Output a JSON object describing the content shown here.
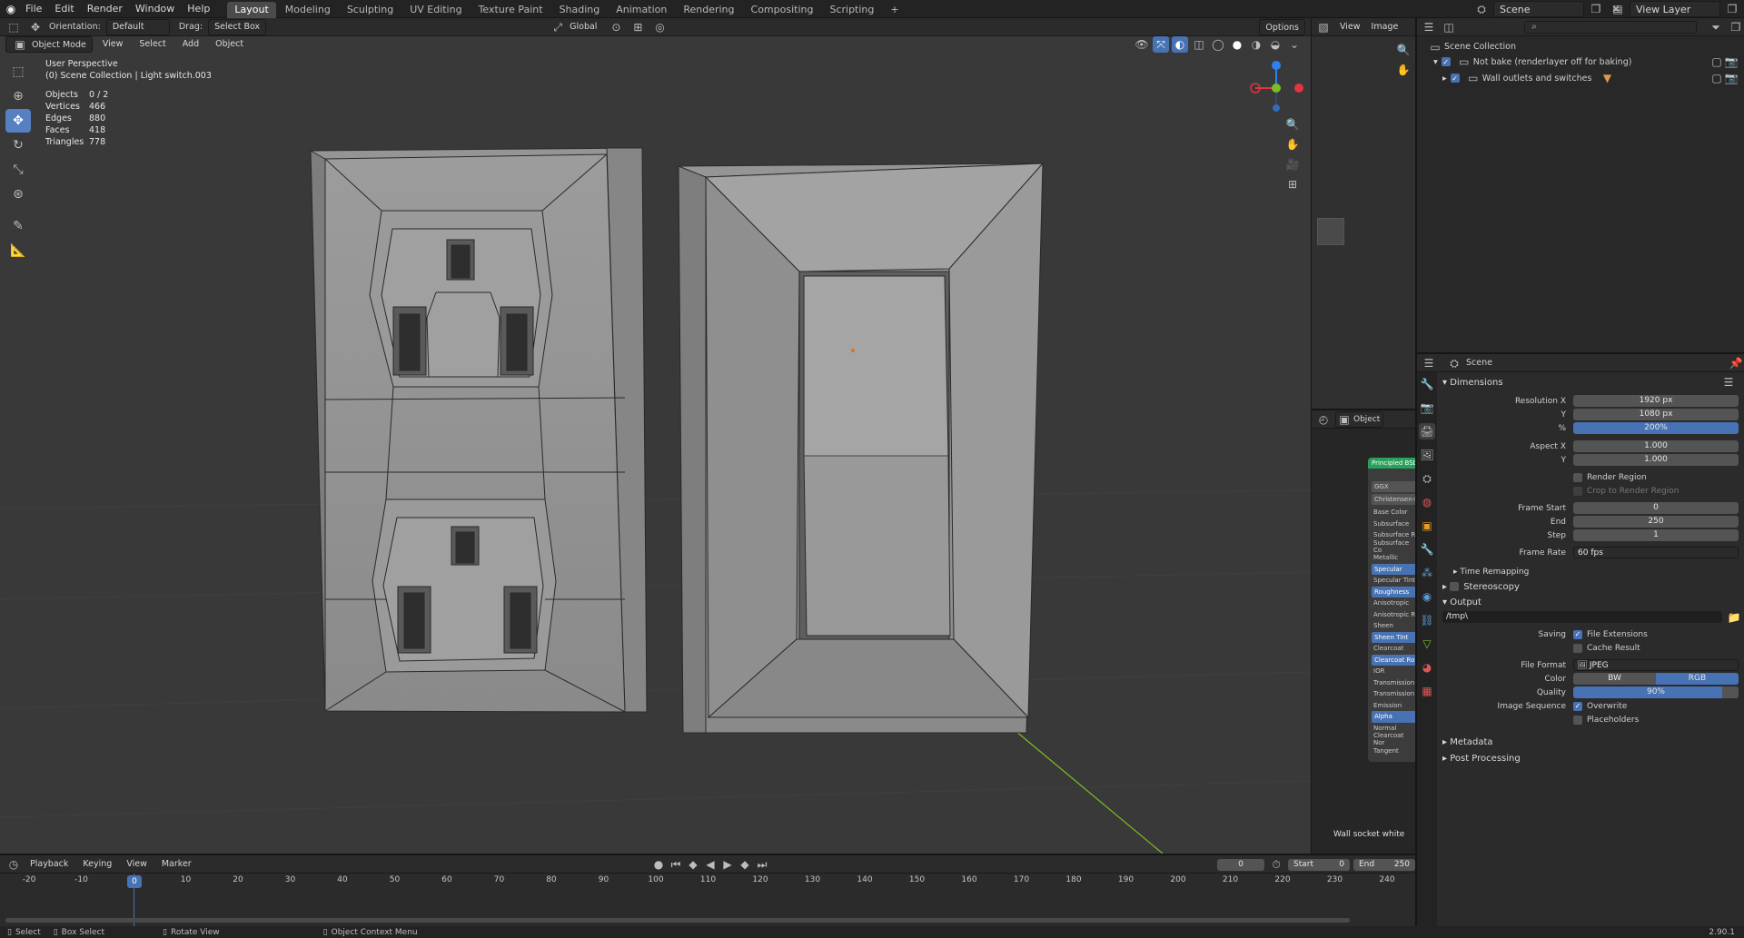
{
  "app": {
    "name": "Blender",
    "version": "2.90.1"
  },
  "menus": [
    "File",
    "Edit",
    "Render",
    "Window",
    "Help"
  ],
  "workspaces": [
    "Layout",
    "Modeling",
    "Sculpting",
    "UV Editing",
    "Texture Paint",
    "Shading",
    "Animation",
    "Rendering",
    "Compositing",
    "Scripting"
  ],
  "active_workspace": "Layout",
  "scene_name": "Scene",
  "view_layer": "View Layer",
  "viewport": {
    "orientation_label": "Orientation:",
    "orientation_value": "Default",
    "drag_label": "Drag:",
    "drag_value": "Select Box",
    "transform_orientation": "Global",
    "options": "Options",
    "mode": "Object Mode",
    "menus": [
      "View",
      "Select",
      "Add",
      "Object"
    ],
    "overlay_title": "User Perspective",
    "overlay_subtitle": "(0) Scene Collection | Light switch.003",
    "stats": [
      {
        "label": "Objects",
        "value": "0 / 2"
      },
      {
        "label": "Vertices",
        "value": "466"
      },
      {
        "label": "Edges",
        "value": "880"
      },
      {
        "label": "Faces",
        "value": "418"
      },
      {
        "label": "Triangles",
        "value": "778"
      }
    ],
    "gizmo_axes": [
      "X",
      "Y",
      "Z"
    ],
    "colors": {
      "bg": "#393939",
      "x": "#e3343f",
      "y": "#7bbd26",
      "z": "#2f80ed",
      "mesh": "#9a9a9a"
    }
  },
  "image_editor": {
    "menus": [
      "View",
      "Image"
    ]
  },
  "node_editor": {
    "object_label": "Object",
    "node_title": "Principled BSDF",
    "dist1": "GGX",
    "dist2": "Christensen-B",
    "sockets": [
      {
        "name": "Base Color",
        "hl": false
      },
      {
        "name": "Subsurface",
        "hl": false
      },
      {
        "name": "Subsurface R",
        "hl": false
      },
      {
        "name": "Subsurface Co",
        "hl": false
      },
      {
        "name": "Metallic",
        "hl": false
      },
      {
        "name": "Specular",
        "hl": true
      },
      {
        "name": "Specular Tint",
        "hl": false
      },
      {
        "name": "Roughness",
        "hl": true
      },
      {
        "name": "Anisotropic",
        "hl": false
      },
      {
        "name": "Anisotropic R",
        "hl": false
      },
      {
        "name": "Sheen",
        "hl": false
      },
      {
        "name": "Sheen Tint",
        "hl": true
      },
      {
        "name": "Clearcoat",
        "hl": false
      },
      {
        "name": "Clearcoat Ro",
        "hl": true
      },
      {
        "name": "IOR",
        "hl": false
      },
      {
        "name": "Transmission",
        "hl": false
      },
      {
        "name": "Transmission",
        "hl": false
      },
      {
        "name": "Emission",
        "hl": false
      },
      {
        "name": "Alpha",
        "hl": true
      },
      {
        "name": "Normal",
        "hl": false
      },
      {
        "name": "Clearcoat Nor",
        "hl": false
      },
      {
        "name": "Tangent",
        "hl": false
      }
    ],
    "material_name": "Wall socket white"
  },
  "outliner": {
    "root": "Scene Collection",
    "items": [
      {
        "label": "Not bake (renderlayer off for baking)"
      },
      {
        "label": "Wall outlets and switches"
      }
    ]
  },
  "properties": {
    "context": "Scene",
    "dimensions": {
      "title": "Dimensions",
      "resolution_x_label": "Resolution X",
      "resolution_x": "1920 px",
      "resolution_y_label": "Y",
      "resolution_y": "1080 px",
      "percent_label": "%",
      "percent": "200%",
      "aspect_x_label": "Aspect X",
      "aspect_x": "1.000",
      "aspect_y_label": "Y",
      "aspect_y": "1.000",
      "render_region": "Render Region",
      "crop_region": "Crop to Render Region",
      "frame_start_label": "Frame Start",
      "frame_start": "0",
      "frame_end_label": "End",
      "frame_end": "250",
      "frame_step_label": "Step",
      "frame_step": "1",
      "frame_rate_label": "Frame Rate",
      "frame_rate": "60 fps"
    },
    "time_remapping": "Time Remapping",
    "stereoscopy": "Stereoscopy",
    "output": {
      "title": "Output",
      "path": "/tmp\\",
      "saving_label": "Saving",
      "file_extensions": "File Extensions",
      "cache_result": "Cache Result",
      "file_format_label": "File Format",
      "file_format": "JPEG",
      "color_label": "Color",
      "color_bw": "BW",
      "color_rgb": "RGB",
      "quality_label": "Quality",
      "quality": "90%",
      "image_sequence_label": "Image Sequence",
      "overwrite": "Overwrite",
      "placeholders": "Placeholders"
    },
    "metadata": "Metadata",
    "post_processing": "Post Processing"
  },
  "timeline": {
    "menus": [
      "Playback",
      "Keying",
      "View",
      "Marker"
    ],
    "current_frame": "0",
    "start_label": "Start",
    "start": "0",
    "end_label": "End",
    "end": "250",
    "ruler": [
      "-20",
      "-10",
      "0",
      "10",
      "20",
      "30",
      "40",
      "50",
      "60",
      "70",
      "80",
      "90",
      "100",
      "110",
      "120",
      "130",
      "140",
      "150",
      "160",
      "170",
      "180",
      "190",
      "200",
      "210",
      "220",
      "230",
      "240"
    ]
  },
  "statusbar": {
    "select": "Select",
    "box_select": "Box Select",
    "rotate": "Rotate View",
    "context_menu": "Object Context Menu",
    "version": "2.90.1"
  }
}
